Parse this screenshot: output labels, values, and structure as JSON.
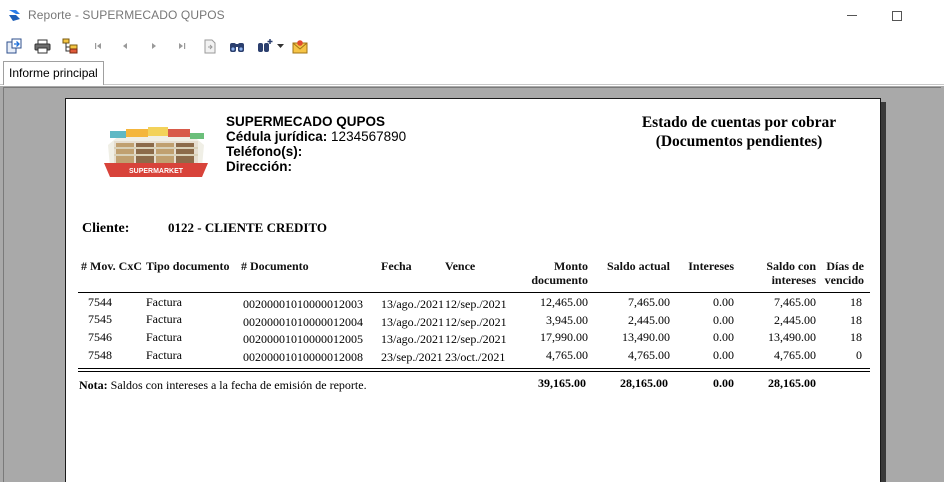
{
  "window": {
    "title": "Reporte  - SUPERMECADO QUPOS"
  },
  "toolbar": {
    "buttons": [
      "export-icon",
      "print-icon",
      "group-tree-icon",
      "first-page-icon",
      "previous-page-icon",
      "next-page-icon",
      "last-page-icon",
      "go-to-page-icon",
      "search-icon",
      "zoom-icon",
      "dropdown-icon",
      "email-icon"
    ]
  },
  "tabs": [
    {
      "label": "Informe principal"
    }
  ],
  "report": {
    "company": "SUPERMECADO QUPOS",
    "cedula_label": "Cédula jurídica:",
    "cedula_value": "1234567890",
    "telefono_label": "Teléfono(s):",
    "direccion_label": "Dirección:",
    "title_line1": "Estado de cuentas por cobrar",
    "title_line2": "(Documentos pendientes)",
    "logo_text": "SUPERMARKET",
    "cliente_label": "Cliente:",
    "cliente_value": "0122 - CLIENTE CREDITO",
    "columns": {
      "mov": "# Mov. CxC",
      "tipo": "Tipo documento",
      "documento": "# Documento",
      "fecha": "Fecha",
      "vence": "Vence",
      "monto_1": "Monto",
      "monto_2": "documento",
      "saldo": "Saldo actual",
      "intereses": "Intereses",
      "saldo_int_1": "Saldo con",
      "saldo_int_2": "intereses",
      "dias_1": "Días de",
      "dias_2": "vencido"
    },
    "rows": [
      {
        "mov": "7544",
        "tipo": "Factura",
        "documento": "00200001010000012003",
        "fecha": "13/ago./2021",
        "vence": "12/sep./2021",
        "monto": "12,465.00",
        "saldo": "7,465.00",
        "intereses": "0.00",
        "saldo_int": "7,465.00",
        "dias": "18"
      },
      {
        "mov": "7545",
        "tipo": "Factura",
        "documento": "00200001010000012004",
        "fecha": "13/ago./2021",
        "vence": "12/sep./2021",
        "monto": "3,945.00",
        "saldo": "2,445.00",
        "intereses": "0.00",
        "saldo_int": "2,445.00",
        "dias": "18"
      },
      {
        "mov": "7546",
        "tipo": "Factura",
        "documento": "00200001010000012005",
        "fecha": "13/ago./2021",
        "vence": "12/sep./2021",
        "monto": "17,990.00",
        "saldo": "13,490.00",
        "intereses": "0.00",
        "saldo_int": "13,490.00",
        "dias": "18"
      },
      {
        "mov": "7548",
        "tipo": "Factura",
        "documento": "00200001010000012008",
        "fecha": "23/sep./2021",
        "vence": "23/oct./2021",
        "monto": "4,765.00",
        "saldo": "4,765.00",
        "intereses": "0.00",
        "saldo_int": "4,765.00",
        "dias": "0"
      }
    ],
    "nota_label": "Nota:",
    "nota_text": " Saldos con intereses a la fecha de emisión de reporte.",
    "totals": {
      "monto": "39,165.00",
      "saldo": "28,165.00",
      "intereses": "0.00",
      "saldo_int": "28,165.00"
    }
  },
  "colors": {
    "viewer_background": "#a9a9a9",
    "accent": "#1e6fd9"
  }
}
